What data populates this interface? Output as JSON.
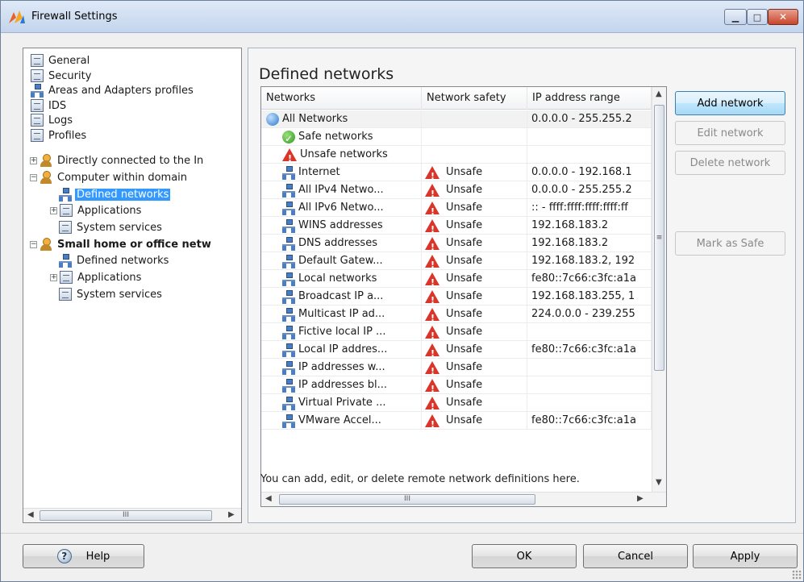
{
  "window": {
    "title": "Firewall Settings"
  },
  "tree": {
    "items": [
      {
        "label": "General",
        "icon": "document-icon",
        "level": 0,
        "expander": "",
        "selected": false,
        "bold": false
      },
      {
        "label": "Security",
        "icon": "document-icon",
        "level": 0,
        "expander": "",
        "selected": false,
        "bold": false
      },
      {
        "label": "Areas and Adapters profiles",
        "icon": "network-icon",
        "level": 0,
        "expander": "",
        "selected": false,
        "bold": false
      },
      {
        "label": "IDS",
        "icon": "document-icon",
        "level": 0,
        "expander": "",
        "selected": false,
        "bold": false
      },
      {
        "label": "Logs",
        "icon": "document-icon",
        "level": 0,
        "expander": "",
        "selected": false,
        "bold": false
      },
      {
        "label": "Profiles",
        "icon": "document-icon",
        "level": 0,
        "expander": "",
        "selected": false,
        "bold": false
      },
      {
        "label": "Directly connected to the In",
        "icon": "user-icon",
        "level": 0,
        "expander": "+",
        "selected": false,
        "bold": false
      },
      {
        "label": "Computer within domain",
        "icon": "user-icon",
        "level": 0,
        "expander": "−",
        "selected": false,
        "bold": false
      },
      {
        "label": "Defined networks",
        "icon": "network-icon",
        "level": 1,
        "expander": "",
        "selected": true,
        "bold": false
      },
      {
        "label": "Applications",
        "icon": "document-icon",
        "level": 1,
        "expander": "+",
        "selected": false,
        "bold": false
      },
      {
        "label": "System services",
        "icon": "document-icon",
        "level": 1,
        "expander": "",
        "selected": false,
        "bold": false
      },
      {
        "label": "Small home or office netw",
        "icon": "user-icon",
        "level": 0,
        "expander": "−",
        "selected": false,
        "bold": true
      },
      {
        "label": "Defined networks",
        "icon": "network-icon",
        "level": 1,
        "expander": "",
        "selected": false,
        "bold": false
      },
      {
        "label": "Applications",
        "icon": "document-icon",
        "level": 1,
        "expander": "+",
        "selected": false,
        "bold": false
      },
      {
        "label": "System services",
        "icon": "document-icon",
        "level": 1,
        "expander": "",
        "selected": false,
        "bold": false
      }
    ]
  },
  "main": {
    "title": "Defined networks",
    "columns": [
      "Networks",
      "Network safety",
      "IP address range"
    ],
    "rows": [
      {
        "name": "All Networks",
        "icon": "globe-icon",
        "indent": 0,
        "safety": "",
        "range": "0.0.0.0 - 255.255.2"
      },
      {
        "name": "Safe networks",
        "icon": "check-icon",
        "indent": 1,
        "safety": "",
        "range": ""
      },
      {
        "name": "Unsafe networks",
        "icon": "warning-icon",
        "indent": 1,
        "safety": "",
        "range": ""
      },
      {
        "name": "Internet",
        "icon": "network-icon",
        "indent": 2,
        "safety": "Unsafe",
        "range": "0.0.0.0 - 192.168.1"
      },
      {
        "name": "All IPv4 Netwo...",
        "icon": "network-icon",
        "indent": 2,
        "safety": "Unsafe",
        "range": "0.0.0.0 - 255.255.2"
      },
      {
        "name": "All IPv6 Netwo...",
        "icon": "network-icon",
        "indent": 2,
        "safety": "Unsafe",
        "range": ":: - ffff:ffff:ffff:ffff:ff"
      },
      {
        "name": "WINS addresses",
        "icon": "network-icon",
        "indent": 2,
        "safety": "Unsafe",
        "range": "192.168.183.2"
      },
      {
        "name": "DNS addresses",
        "icon": "network-icon",
        "indent": 2,
        "safety": "Unsafe",
        "range": "192.168.183.2"
      },
      {
        "name": "Default Gatew...",
        "icon": "network-icon",
        "indent": 2,
        "safety": "Unsafe",
        "range": "192.168.183.2, 192"
      },
      {
        "name": "Local networks",
        "icon": "network-icon",
        "indent": 2,
        "safety": "Unsafe",
        "range": "fe80::7c66:c3fc:a1a"
      },
      {
        "name": "Broadcast IP a...",
        "icon": "network-icon",
        "indent": 2,
        "safety": "Unsafe",
        "range": "192.168.183.255, 1"
      },
      {
        "name": "Multicast IP ad...",
        "icon": "network-icon",
        "indent": 2,
        "safety": "Unsafe",
        "range": "224.0.0.0 - 239.255"
      },
      {
        "name": "Fictive local IP ...",
        "icon": "network-icon",
        "indent": 2,
        "safety": "Unsafe",
        "range": ""
      },
      {
        "name": "Local IP addres...",
        "icon": "network-icon",
        "indent": 2,
        "safety": "Unsafe",
        "range": "fe80::7c66:c3fc:a1a"
      },
      {
        "name": "IP addresses w...",
        "icon": "network-icon",
        "indent": 2,
        "safety": "Unsafe",
        "range": ""
      },
      {
        "name": "IP addresses bl...",
        "icon": "network-icon",
        "indent": 2,
        "safety": "Unsafe",
        "range": ""
      },
      {
        "name": "Virtual Private ...",
        "icon": "network-icon",
        "indent": 2,
        "safety": "Unsafe",
        "range": ""
      },
      {
        "name": "VMware Accel...",
        "icon": "network-icon",
        "indent": 2,
        "safety": "Unsafe",
        "range": "fe80::7c66:c3fc:a1a"
      }
    ],
    "hint": "You can add, edit, or delete remote network definitions here.",
    "buttons": {
      "add": "Add network",
      "edit": "Edit network",
      "delete": "Delete network",
      "mark_safe": "Mark as Safe"
    }
  },
  "footer": {
    "help": "Help",
    "ok": "OK",
    "cancel": "Cancel",
    "apply": "Apply"
  },
  "scroll_glyph": "III",
  "colors": {
    "selection": "#3399ff",
    "unsafe": "#d9362b",
    "safe": "#2e9a26"
  }
}
